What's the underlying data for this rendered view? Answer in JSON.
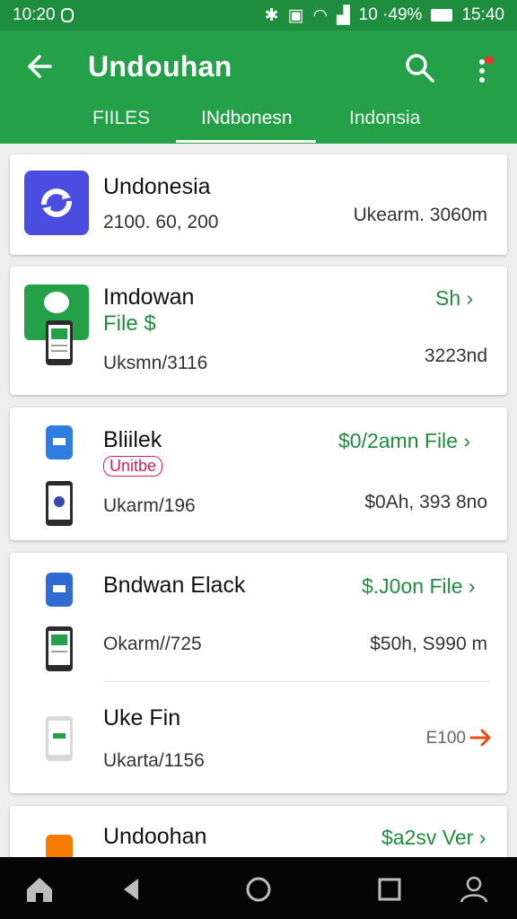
{
  "status_bar": {
    "time": "10:20",
    "right_text": "10 ·49%",
    "clock": "15:40"
  },
  "appbar": {
    "title": "Undouhan",
    "back_icon": "arrow-back-icon",
    "search_icon": "search-icon",
    "more_icon": "more-vert-icon"
  },
  "tabs": [
    {
      "label": "FIILES"
    },
    {
      "label": "INdbonesn"
    },
    {
      "label": "Indonsia"
    }
  ],
  "items": [
    {
      "name": "Undonesia",
      "sub": "2100. 60, 200",
      "right": "Ukearm. 3060m"
    },
    {
      "name": "Imdowan",
      "green_sub": "File $",
      "action": "Sh",
      "sub": "Uksmn/3116",
      "right": "3223nd"
    },
    {
      "name": "Bliilek",
      "badge": "Unitbe",
      "action": "$0/2amn File",
      "sub": "Ukarm/196",
      "right": "$0Ah, 393 8no"
    },
    {
      "name": "Bndwan Elack",
      "action": "$.J0on File",
      "sub": "Okarm//725",
      "right": "$50h, S990 m"
    },
    {
      "name": "Uke Fin",
      "sub": "Ukarta/1156",
      "right": "E100"
    },
    {
      "name": "Undoohan",
      "action": "$a2sv Ver"
    }
  ],
  "colors": {
    "primary": "#24a148",
    "status": "#1e8e3e",
    "accent_text": "#1e8e3e",
    "badge": "#d81b60",
    "arrow_red": "#e64a19"
  },
  "navbar": [
    "home-icon",
    "back-triangle-icon",
    "home-circle-icon",
    "recents-square-icon",
    "profile-icon"
  ]
}
